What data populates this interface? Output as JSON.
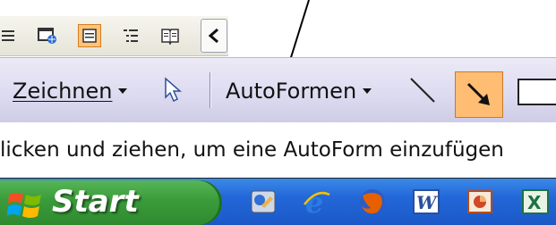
{
  "view_toolbar": {
    "icons": [
      "normal-view-icon",
      "web-view-icon",
      "print-layout-view-icon",
      "outline-view-icon",
      "reading-view-icon"
    ],
    "active_icon": "print-layout-view-icon",
    "scroll_left_icon": "chevron-left-icon"
  },
  "drawing_toolbar": {
    "draw_menu_label": "Zeichnen",
    "select_icon": "select-objects-arrow-icon",
    "autoshapes_menu_label": "AutoFormen",
    "tools": [
      "line-icon",
      "arrow-icon",
      "rectangle-icon"
    ],
    "active_tool": "arrow-icon",
    "accent": "#ffbd73"
  },
  "status": {
    "text": "licken und ziehen, um eine AutoForm einzufügen"
  },
  "taskbar": {
    "start_label": "Start",
    "quick_launch_icons": [
      "paint-icon",
      "internet-explorer-icon",
      "firefox-icon",
      "word-icon",
      "powerpoint-icon",
      "excel-icon"
    ],
    "color": "#2367d8",
    "start_color": "#3a9b3a"
  }
}
